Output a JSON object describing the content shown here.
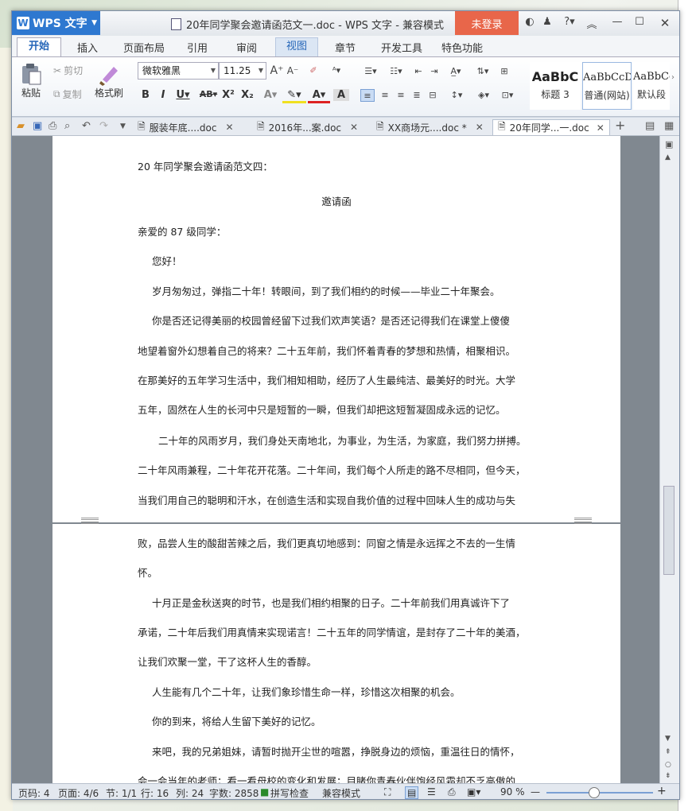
{
  "app": {
    "name": "WPS 文字",
    "title": "20年同学聚会邀请函范文一.doc - WPS 文字 - 兼容模式",
    "login": "未登录"
  },
  "menus": [
    "开始",
    "插入",
    "页面布局",
    "引用",
    "审阅",
    "视图",
    "章节",
    "开发工具",
    "特色功能"
  ],
  "ribbon": {
    "paste": "粘贴",
    "cut": "剪切",
    "copy": "复制",
    "format_painter": "格式刷",
    "font": "微软雅黑",
    "size": "11.25",
    "styles": [
      {
        "sample": "AaBbC",
        "label": "标题 3"
      },
      {
        "sample": "AaBbCcD",
        "label": "普通(网站)"
      },
      {
        "sample": "AaBbCc",
        "label": "默认段"
      }
    ]
  },
  "tabs": [
    {
      "label": "服装年底....doc"
    },
    {
      "label": "2016年...案.doc"
    },
    {
      "label": "XX商场元....doc *"
    },
    {
      "label": "20年同学...一.doc"
    }
  ],
  "page1": [
    "20 年同学聚会邀请函范文四：",
    "邀请函",
    "亲爱的 87 级同学：",
    "您好！",
    "岁月匆匆过，弹指二十年！转眼间，到了我们相约的时候——毕业二十年聚会。",
    "你是否还记得美丽的校园曾经留下过我们欢声笑语？是否还记得我们在课堂上傻傻",
    "地望着窗外幻想着自己的将来？二十五年前，我们怀着青春的梦想和热情，相聚相识。",
    "在那美好的五年学习生活中，我们相知相助，经历了人生最纯洁、最美好的时光。大学",
    "五年，固然在人生的长河中只是短暂的一瞬，但我们却把这短暂凝固成永远的记忆。",
    "二十年的风雨岁月，我们身处天南地北，为事业，为生活，为家庭，我们努力拼搏。",
    "二十年风雨兼程，二十年花开花落。二十年间，我们每个人所走的路不尽相同，但今天，",
    "当我们用自己的聪明和汗水，在创造生活和实现自我价值的过程中回味人生的成功与失"
  ],
  "page2": [
    "败，品尝人生的酸甜苦辣之后，我们更真切地感到：同窗之情是永远挥之不去的一生情",
    "怀。",
    "十月正是金秋送爽的时节，也是我们相约相聚的日子。二十年前我们用真诚许下了",
    "承诺，二十年后我们用真情来实现诺言！二十五年的同学情谊，是封存了二十年的美酒，",
    "让我们欢聚一堂，干了这杯人生的香醇。",
    "人生能有几个二十年，让我们象珍惜生命一样，珍惜这次相聚的机会。",
    "你的到来，将给人生留下美好的记忆。",
    "来吧，我的兄弟姐妹，请暂时抛开尘世的喧嚣，挣脱身边的烦恼，重温往日的情怀，",
    "会一会当年的老师；看一看母校的变化和发展；目睹你青春伙伴饱经风霜却不乏高傲的"
  ],
  "status": {
    "page": "页码: 4",
    "pages": "页面: 4/6",
    "section": "节: 1/1",
    "row": "行: 16",
    "col": "列: 24",
    "words": "字数: 2858",
    "spell": "拼写检查",
    "mode": "兼容模式",
    "zoom": "90 %",
    "zoom_level": 0.45
  }
}
